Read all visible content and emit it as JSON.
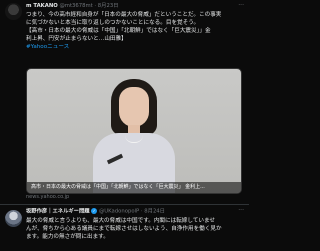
{
  "tweet1": {
    "name": "m TAKANO",
    "handle": "@mt3678mt · 8月23日",
    "text_lines": [
      "つまり、今の高市経和自身が「日本の最大の脅威」だということだ。この事実",
      "に気づかないと本当に取り返しのつかないことになる。目を覚そう。",
      "【高市・日本の最大の脅威は「中国」「北朝鮮」ではなく「巨大震災」」金",
      "利上昇、円安が止まらないと…山田雅】"
    ],
    "hashtag": "#Yahooニュース",
    "media_caption": "高市・日本の最大の脅威は「中国」「北朝鮮」ではなく「巨大震災」 金利上...",
    "source": "news.yahoo.co.jp"
  },
  "tweet2": {
    "name": "坂野作彦｜エネルギー問題",
    "handle": "@UKadonopolP · 8月24日",
    "text_lines": [
      "最大の脅威と言うよりも、最大の脅威は中国です。内閣には転嫁していませ",
      "んが、脅ちから心ある議員にまで転嫁させはしないよう、自浄作用を働く見か",
      "ます。能力の無さが問に出ます。"
    ]
  },
  "colors": {
    "link": "#1d9bf0",
    "verified": "#1d9bf0",
    "highlight": "#e0245e"
  },
  "icons": [
    "verified-badge-icon",
    "more-icon"
  ]
}
